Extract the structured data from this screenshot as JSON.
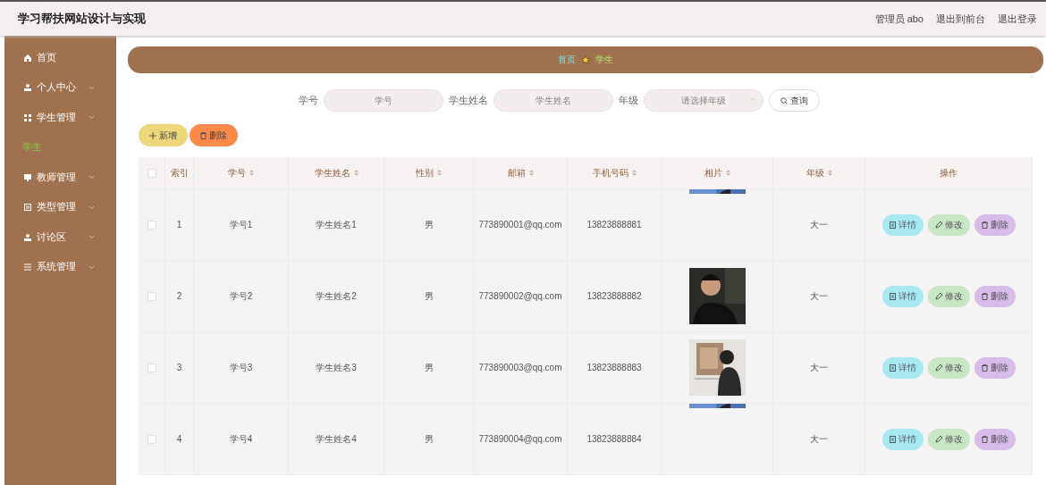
{
  "header": {
    "title": "学习帮扶网站设计与实现",
    "links": [
      "管理员 abo",
      "退出到前台",
      "退出登录"
    ]
  },
  "sidebar": {
    "items": [
      {
        "label": "首页",
        "expandable": false,
        "active": false
      },
      {
        "label": "个人中心",
        "expandable": true,
        "active": false
      },
      {
        "label": "学生管理",
        "expandable": true,
        "active": false
      },
      {
        "label": "学生",
        "expandable": false,
        "active": true
      },
      {
        "label": "教师管理",
        "expandable": true,
        "active": false
      },
      {
        "label": "类型管理",
        "expandable": true,
        "active": false
      },
      {
        "label": "讨论区",
        "expandable": true,
        "active": false
      },
      {
        "label": "系统管理",
        "expandable": true,
        "active": false
      }
    ]
  },
  "breadcrumb": [
    "首页",
    "学生"
  ],
  "search": {
    "fields": [
      {
        "label": "学号",
        "placeholder": "学号",
        "kind": "text"
      },
      {
        "label": "学生姓名",
        "placeholder": "学生姓名",
        "kind": "text"
      },
      {
        "label": "年级",
        "placeholder": "请选择年级",
        "kind": "select"
      }
    ],
    "button": "查询"
  },
  "actions": [
    "新增",
    "删除"
  ],
  "table": {
    "columns": [
      "索引",
      "学号",
      "学生姓名",
      "性别",
      "邮箱",
      "手机号码",
      "相片",
      "年级",
      "操作"
    ],
    "all_checked": false,
    "rows": [
      {
        "index": "1",
        "id": "学号1",
        "name": "学生姓名1",
        "gender": "男",
        "email": "773890001@qq.com",
        "phone": "13823888881",
        "grade": "大一",
        "checked": false,
        "buttons": [
          "详情",
          "修改",
          "删除"
        ]
      },
      {
        "index": "2",
        "id": "学号2",
        "name": "学生姓名2",
        "gender": "男",
        "email": "773890002@qq.com",
        "phone": "13823888882",
        "grade": "大一",
        "checked": false,
        "buttons": [
          "详情",
          "修改",
          "删除"
        ]
      },
      {
        "index": "3",
        "id": "学号3",
        "name": "学生姓名3",
        "gender": "男",
        "email": "773890003@qq.com",
        "phone": "13823888883",
        "grade": "大一",
        "checked": false,
        "buttons": [
          "详情",
          "修改",
          "删除"
        ]
      },
      {
        "index": "4",
        "id": "学号4",
        "name": "学生姓名4",
        "gender": "男",
        "email": "773890004@qq.com",
        "phone": "13823888884",
        "grade": "大一",
        "checked": false,
        "buttons": [
          "详情",
          "修改",
          "删除"
        ]
      }
    ]
  }
}
